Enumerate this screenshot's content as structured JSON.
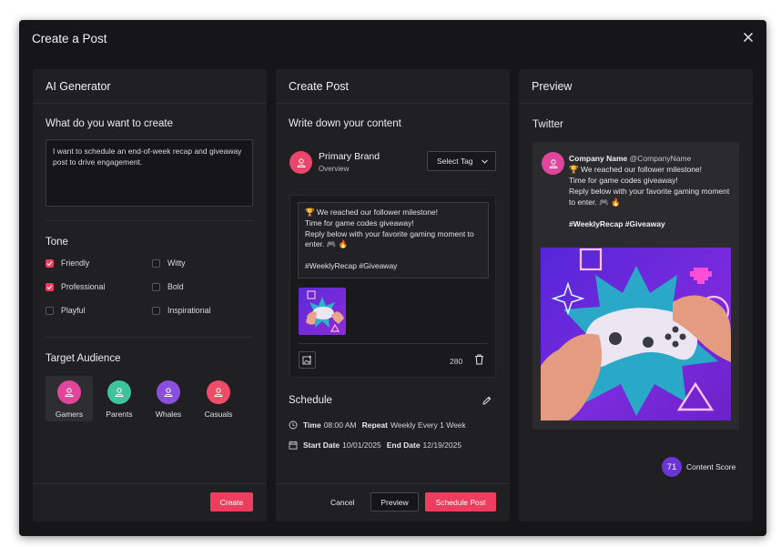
{
  "modal": {
    "title": "Create a Post"
  },
  "ai": {
    "title": "AI Generator",
    "prompt_label": "What do you want to create",
    "prompt_text": "I want to schedule an end-of-week recap and giveaway post to drive engagement.",
    "tone_label": "Tone",
    "tones": [
      {
        "label": "Friendly",
        "checked": true
      },
      {
        "label": "Witty",
        "checked": false
      },
      {
        "label": "Professional",
        "checked": true
      },
      {
        "label": "Bold",
        "checked": false
      },
      {
        "label": "Playful",
        "checked": false
      },
      {
        "label": "Inspirational",
        "checked": false
      }
    ],
    "audience_label": "Target Audience",
    "audiences": [
      {
        "label": "Gamers",
        "color": "#e0479a",
        "selected": true
      },
      {
        "label": "Parents",
        "color": "#3ec49a",
        "selected": false
      },
      {
        "label": "Whales",
        "color": "#8b4fe0",
        "selected": false
      },
      {
        "label": "Casuals",
        "color": "#ef4d67",
        "selected": false
      }
    ],
    "create_label": "Create"
  },
  "create": {
    "title": "Create Post",
    "content_label": "Write down your content",
    "brand_name": "Primary Brand",
    "brand_sub": "Overview",
    "select_tag": "Select Tag",
    "post_lines": [
      "🏆 We reached our follower milestone!",
      "Time for game codes giveaway!",
      "Reply below with your favorite gaming moment to enter. 🎮 🔥",
      "",
      "#WeeklyRecap #Giveaway"
    ],
    "char_count": "280",
    "schedule_label": "Schedule",
    "time_label": "Time",
    "time_value": "08:00 AM",
    "repeat_label": "Repeat",
    "repeat_value": "Weekly Every 1 Week",
    "start_label": "Start Date",
    "start_value": "10/01/2025",
    "end_label": "End Date",
    "end_value": "12/19/2025",
    "cancel_label": "Cancel",
    "preview_label": "Preview",
    "schedule_btn_label": "Schedule Post"
  },
  "preview": {
    "title": "Preview",
    "platform": "Twitter",
    "company_name": "Company Name",
    "company_handle": "@CompanyName",
    "tweet_lines": [
      "🏆 We reached our follower milestone!",
      "Time for game codes giveaway!",
      "Reply below with your favorite gaming moment to enter. 🎮 🔥"
    ],
    "tweet_tags": "#WeeklyRecap #Giveaway",
    "score_value": "71",
    "score_label": "Content Score"
  },
  "colors": {
    "accent": "#ef3d5f",
    "score": "#6a35d6",
    "panel": "#202022",
    "modal": "#161618"
  }
}
